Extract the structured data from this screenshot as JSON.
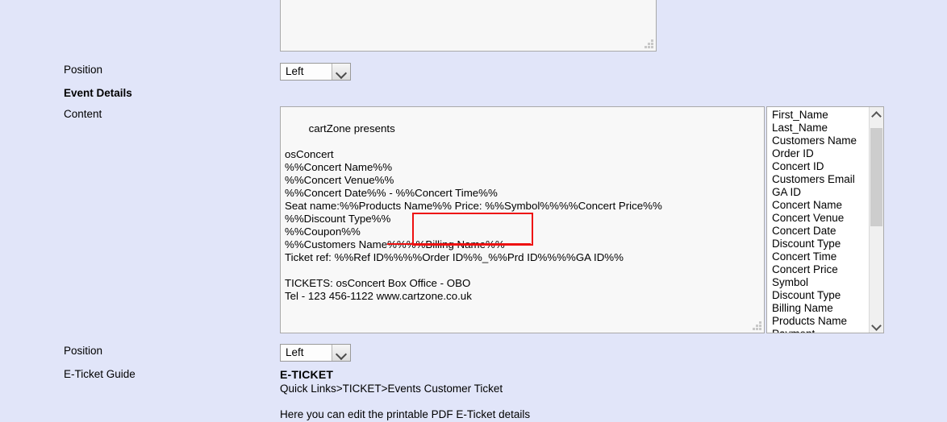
{
  "page": {
    "background_color": "#e1e5f9"
  },
  "rows": {
    "position_top": {
      "label": "Position",
      "select_value": "Left"
    },
    "section_heading": {
      "label": "Event Details"
    },
    "content": {
      "label": "Content",
      "textarea_value": "cartZone presents\n\nosConcert\n%%Concert Name%%\n%%Concert Venue%%\n%%Concert Date%% - %%Concert Time%%\nSeat name:%%Products Name%% Price: %%Symbol%%%%Concert Price%%\n%%Discount Type%%\n%%Coupon%%\n%%Customers Name%%%%Billing Name%%\nTicket ref: %%Ref ID%%%%Order ID%%_%%Prd ID%%%%GA ID%%\n\nTICKETS: osConcert Box Office - OBO\nTel - 123 456-1122 www.cartzone.co.uk"
    },
    "position_bottom": {
      "label": "Position",
      "select_value": "Left"
    },
    "eticket_guide": {
      "label": "E-Ticket Guide",
      "title": "E-TICKET",
      "path": "Quick Links>TICKET>Events Customer Ticket",
      "description": "Here you can edit the printable PDF E-Ticket details"
    }
  },
  "token_list": {
    "items": [
      "First_Name",
      "Last_Name",
      "Customers Name",
      "Order ID",
      "Concert ID",
      "Customers Email",
      "GA ID",
      "Concert Name",
      "Concert Venue",
      "Concert Date",
      "Discount Type",
      "Concert Time",
      "Concert Price",
      "Symbol",
      "Discount Type",
      "Billing Name",
      "Products Name",
      "Payment"
    ],
    "scroll_up_icon": "chevron-up-icon",
    "scroll_down_icon": "chevron-down-icon"
  },
  "annotations": {
    "highlight_color": "#ee1111",
    "highlight_target": "%%Billing Name%%",
    "strikethrough_target": "%%Order ID%%_%%P"
  }
}
